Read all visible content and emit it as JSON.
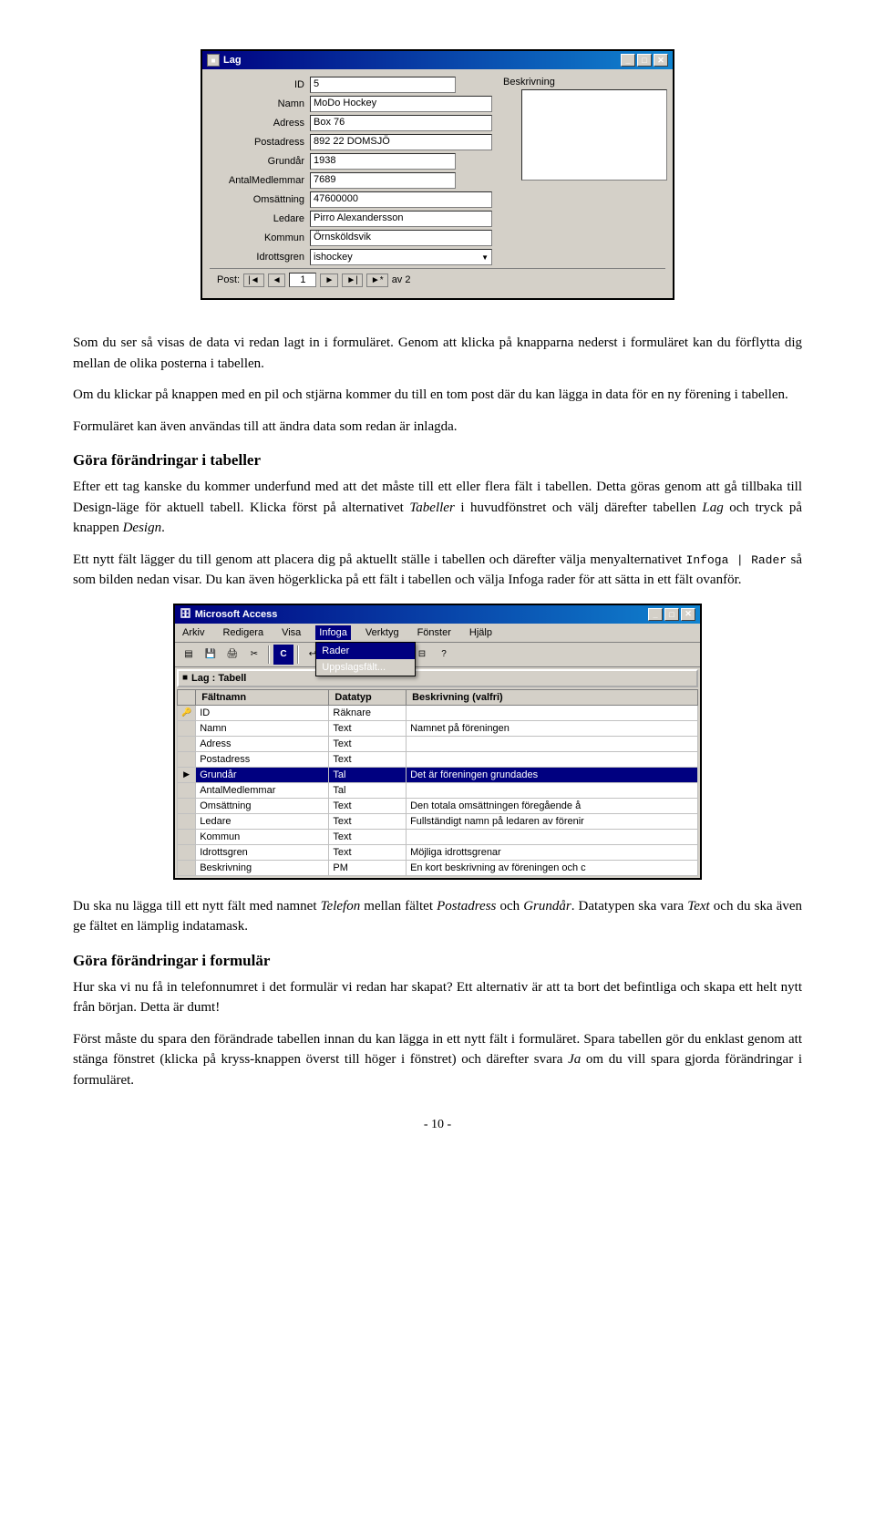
{
  "dialog": {
    "title": "Lag",
    "title_icon": "■",
    "fields": [
      {
        "label": "ID",
        "value": "5"
      },
      {
        "label": "Namn",
        "value": "MoDo Hockey"
      },
      {
        "label": "Adress",
        "value": "Box 76"
      },
      {
        "label": "Postadress",
        "value": "892 22 DOMSJÖ"
      },
      {
        "label": "Grundår",
        "value": "1938"
      },
      {
        "label": "AntalMedlemmar",
        "value": "7689"
      },
      {
        "label": "Omsättning",
        "value": "47600000"
      },
      {
        "label": "Ledare",
        "value": "Pirro Alexandersson"
      },
      {
        "label": "Kommun",
        "value": "Örnsköldsvik"
      },
      {
        "label": "Idrottsgren",
        "value": "ishockey",
        "has_dropdown": true
      }
    ],
    "nav": {
      "label": "Post:",
      "current": "1",
      "total_label": "av 2"
    },
    "btn_minimize": "_",
    "btn_maximize": "□",
    "btn_close": "✕"
  },
  "paragraphs": {
    "p1": "Som du ser så visas de data vi redan lagt in i formuläret. Genom att klicka på knapparna nederst i formuläret kan du förflytta dig mellan de olika posterna i tabellen.",
    "p2": "Om du klickar på knappen med en pil och stjärna kommer du till en tom post där du kan lägga in data för en ny förening i tabellen.",
    "p3": "Formuläret kan även användas till att ändra data som redan är inlagda.",
    "heading1": "Göra förändringar i tabeller",
    "p4": "Efter ett tag kanske du kommer underfund med att det måste till ett eller flera fält i tabellen. Detta göras genom att gå tillbaka till Design-läge för aktuell tabell. Klicka först på alternativet ",
    "p4_italic": "Tabeller",
    "p4_rest": " i huvudfönstret och välj därefter tabellen ",
    "p4_italic2": "Lag",
    "p4_rest2": " och tryck på knappen ",
    "p4_italic3": "Design",
    "p4_end": ".",
    "p5_start": "Ett nytt fält lägger du till genom att placera dig på aktuellt ställe i tabellen och därefter välja menyalternativet ",
    "p5_mono": "Infoga | Rader",
    "p5_rest": " så som bilden nedan visar. Du kan även högerklicka på ett fält i tabellen och välja Infoga rader för att sätta in ett fält ovanför.",
    "heading2": "Göra förändringar i formulär",
    "p6": "Hur ska vi nu få in telefonnumret i det formulär vi redan har skapat? Ett alternativ är att ta bort det befintliga och skapa ett helt nytt från början. Detta är dumt!",
    "p7_start": "Du ska nu lägga till ett nytt fält med namnet ",
    "p7_italic": "Telefon",
    "p7_rest": " mellan fältet ",
    "p7_italic2": "Postadress",
    "p7_rest2": " och ",
    "p7_italic3": "Grundår",
    "p7_end": ". Datatypen ska vara ",
    "p7_italic4": "Text",
    "p7_end2": " och du ska även ge fältet en lämplig indatamask.",
    "p8": "Först måste du spara den förändrade tabellen innan du kan lägga in ett nytt fält i formuläret. Spara tabellen gör du enklast genom att stänga fönstret (klicka på kryss-knappen överst till höger i fönstret) och därefter svara ",
    "p8_italic": "Ja",
    "p8_end": " om du vill spara gjorda förändringar i formuläret."
  },
  "access_window": {
    "title": "Microsoft Access",
    "menubar": [
      "Arkiv",
      "Redigera",
      "Visa",
      "Infoga",
      "Verktyg",
      "Fönster",
      "Hjälp"
    ],
    "active_menu": "Infoga",
    "infoga_items": [
      "Rader",
      "Uppslag­fält..."
    ],
    "highlighted_infoga": "Rader",
    "table_title": "Lag : Tabell",
    "table_columns": [
      "Fältnamn",
      "Datatyp",
      "Beskrivning (valfri)"
    ],
    "table_rows": [
      {
        "icon": "key",
        "name": "ID",
        "type": "Räknare",
        "desc": ""
      },
      {
        "icon": "",
        "name": "Namn",
        "type": "Text",
        "desc": "Namnet på föreningen"
      },
      {
        "icon": "",
        "name": "Adress",
        "type": "Text",
        "desc": ""
      },
      {
        "icon": "",
        "name": "Postadress",
        "type": "Text",
        "desc": ""
      },
      {
        "icon": "▶",
        "name": "Grundår",
        "type": "Tal",
        "desc": "Det är föreningen grundades"
      },
      {
        "icon": "",
        "name": "AntalMedlemmar",
        "type": "Tal",
        "desc": ""
      },
      {
        "icon": "",
        "name": "Omsättning",
        "type": "Text",
        "desc": "Den totala omsättningen föregående å"
      },
      {
        "icon": "",
        "name": "Ledare",
        "type": "Text",
        "desc": "Fullständigt namn på ledaren av förenir"
      },
      {
        "icon": "",
        "name": "Kommun",
        "type": "Text",
        "desc": ""
      },
      {
        "icon": "",
        "name": "Idrottsgren",
        "type": "Text",
        "desc": "Möjliga idrottsgrenar"
      },
      {
        "icon": "",
        "name": "Beskrivning",
        "type": "PM",
        "desc": "En kort beskrivning av föreningen och c"
      }
    ]
  },
  "page_number": "- 10 -"
}
